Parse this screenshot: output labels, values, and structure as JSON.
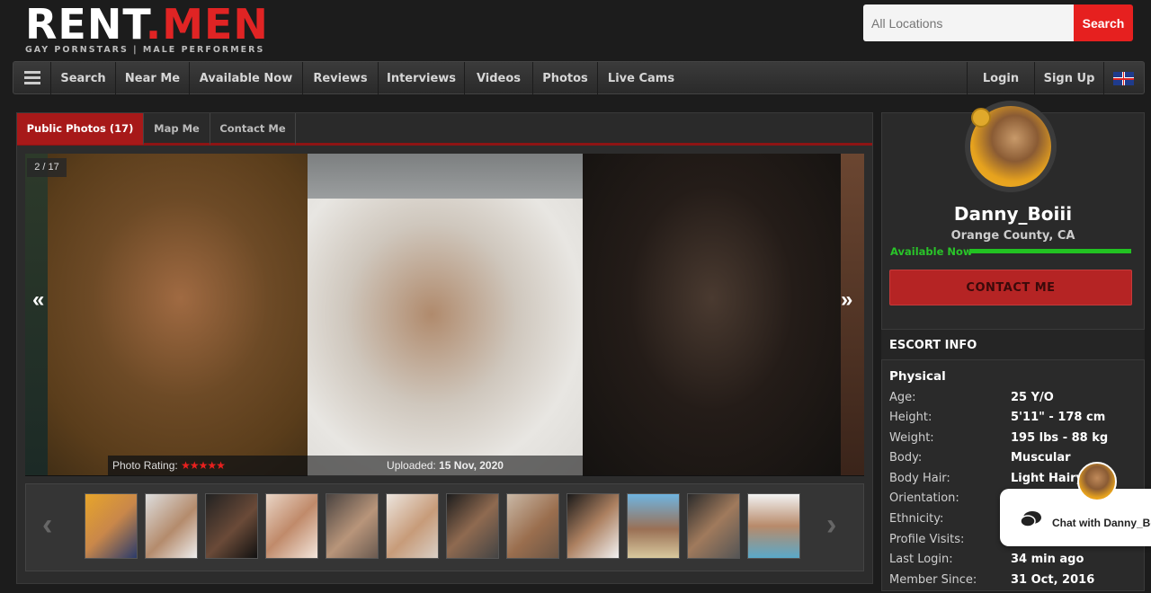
{
  "header": {
    "logo_main_a": "RENT",
    "logo_main_b": ".MEN",
    "logo_tagline": "GAY PORNSTARS | MALE PERFORMERS",
    "search_placeholder": "All Locations",
    "search_button": "Search"
  },
  "nav": {
    "items": [
      "Search",
      "Near Me",
      "Available Now",
      "Reviews",
      "Interviews",
      "Videos",
      "Photos",
      "Live Cams"
    ],
    "login": "Login",
    "signup": "Sign Up"
  },
  "tabs": [
    {
      "label": "Public Photos (17)",
      "active": true
    },
    {
      "label": "Map Me",
      "active": false
    },
    {
      "label": "Contact Me",
      "active": false
    }
  ],
  "gallery": {
    "counter": "2 / 17",
    "prev": "«",
    "next": "»",
    "rating_label": "Photo Rating:",
    "stars": "★★★★★",
    "uploaded_label": "Uploaded:",
    "uploaded_date": "15 Nov, 2020",
    "thumb_prev": "‹",
    "thumb_next": "›"
  },
  "profile": {
    "username": "Danny_Boiii",
    "location": "Orange County, CA",
    "availability": "Available Now",
    "contact_button": "CONTACT ME",
    "info_heading": "ESCORT INFO",
    "section_physical": "Physical",
    "rows": [
      {
        "key": "Age:",
        "value": "25 Y/O"
      },
      {
        "key": "Height:",
        "value": "5'11\" - 178 cm"
      },
      {
        "key": "Weight:",
        "value": "195 lbs - 88 kg"
      },
      {
        "key": "Body:",
        "value": "Muscular"
      },
      {
        "key": "Body Hair:",
        "value": "Light Hairy"
      },
      {
        "key": "Orientation:",
        "value": ""
      },
      {
        "key": "Ethnicity:",
        "value": ""
      },
      {
        "key": "Profile Visits:",
        "value": ""
      },
      {
        "key": "Last Login:",
        "value": "34 min ago"
      },
      {
        "key": "Member Since:",
        "value": "31 Oct, 2016"
      }
    ]
  },
  "chat": {
    "label": "Chat with Danny_Boiii"
  },
  "colors": {
    "brand_red": "#e6201f",
    "tab_active": "#a71919",
    "available_green": "#29c429"
  }
}
